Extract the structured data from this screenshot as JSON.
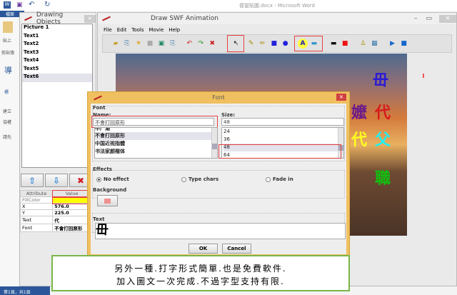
{
  "word": {
    "title": "便當貼圖.docx - Microsoft Word",
    "file_tab": "檔案",
    "ribbon": [
      "貼上",
      "剪貼簿",
      "導",
      "標",
      "建立",
      "協權",
      "請先"
    ],
    "status": "第1頁，共1頁"
  },
  "objects_window": {
    "title": "Drawing Objects",
    "items": [
      "Picture 1",
      "Text1",
      "Text2",
      "Text3",
      "Text4",
      "Text5",
      "Text6"
    ],
    "selected": 6,
    "table": {
      "headers": [
        "Attribute",
        "Value"
      ],
      "rows": [
        [
          "FillColor",
          ""
        ],
        [
          "X",
          "576.0"
        ],
        [
          "Y",
          "225.0"
        ],
        [
          "Text",
          "代"
        ],
        [
          "Font",
          "不會打回原形"
        ]
      ]
    },
    "fill_color": "#ffff00"
  },
  "swf_window": {
    "title": "Draw SWF Animation",
    "menu": [
      "File",
      "Edit",
      "Tools",
      "Movie",
      "Help"
    ],
    "canvas_chars": [
      {
        "t": "毌",
        "c": "#2a1ad8"
      },
      {
        "t": "嬤",
        "c": "#6a1a8a"
      },
      {
        "t": "代",
        "c": "#d81a1a"
      },
      {
        "t": "代",
        "c": "#ffff20"
      },
      {
        "t": "父",
        "c": "#20f0f0"
      },
      {
        "t": "職",
        "c": "#10c010"
      }
    ]
  },
  "font_dialog": {
    "title": "Font",
    "font_group": "Font",
    "name_label": "Name:",
    "name_value": "不會打回原形",
    "names": [
      "中广潮",
      "不會打回原形",
      "中国近视指體",
      "书法家颜楷体"
    ],
    "size_label": "Size:",
    "size_value": "48",
    "sizes": [
      "24",
      "36",
      "48",
      "64"
    ],
    "effects_label": "Effects",
    "effects": [
      "No effect",
      "Type chars",
      "Fade in"
    ],
    "effect_selected": 0,
    "background_label": "Background",
    "background_color": "#f09090",
    "text_label": "Text",
    "text_value": "毌",
    "ok": "OK",
    "cancel": "Cancel"
  },
  "caption": {
    "line1": "另外一種.打字形式簡單.也是免費軟件.",
    "line2": "加入圖文一次完成.不過字型支持有限."
  }
}
